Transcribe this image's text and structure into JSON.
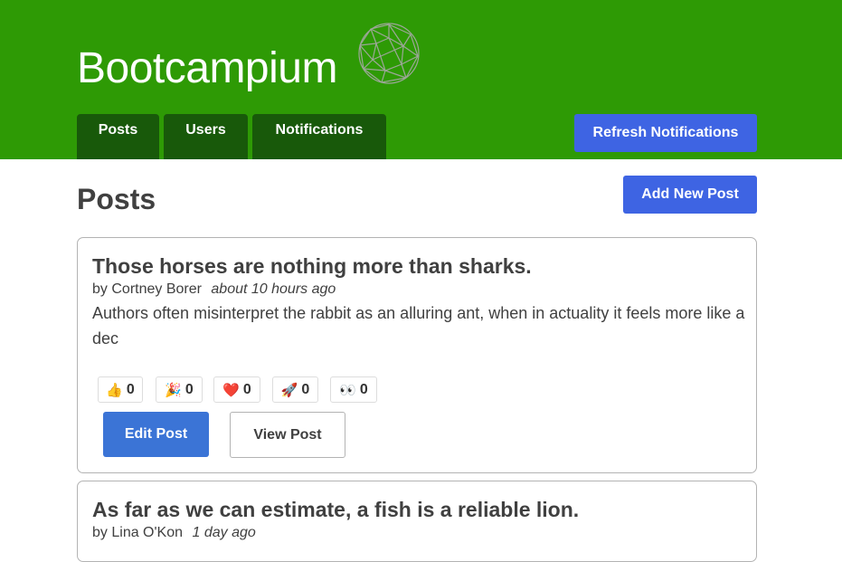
{
  "header": {
    "brand": "Bootcampium",
    "logo_icon": "geodesic-sphere-icon",
    "tabs": [
      {
        "label": "Posts"
      },
      {
        "label": "Users"
      },
      {
        "label": "Notifications"
      }
    ],
    "refresh_label": "Refresh Notifications"
  },
  "main": {
    "title": "Posts",
    "add_label": "Add New Post"
  },
  "posts": [
    {
      "title": "Those horses are nothing more than sharks.",
      "author_prefix": "by",
      "author": "Cortney Borer",
      "time": "about 10 hours ago",
      "excerpt": "Authors often misinterpret the rabbit as an alluring ant, when in actuality it feels more like a dec",
      "reactions": [
        {
          "icon": "thumbs-up-icon",
          "emoji": "👍",
          "count": "0"
        },
        {
          "icon": "party-popper-icon",
          "emoji": "🎉",
          "count": "0"
        },
        {
          "icon": "heart-icon",
          "emoji": "❤️",
          "count": "0"
        },
        {
          "icon": "rocket-icon",
          "emoji": "🚀",
          "count": "0"
        },
        {
          "icon": "eyes-icon",
          "emoji": "👀",
          "count": "0"
        }
      ],
      "edit_label": "Edit Post",
      "view_label": "View Post"
    },
    {
      "title": "As far as we can estimate, a fish is a reliable lion.",
      "author_prefix": "by",
      "author": "Lina O'Kon",
      "time": "1 day ago"
    }
  ],
  "colors": {
    "header_bg": "#2e9a05",
    "tab_bg": "#18590a",
    "primary_button": "#3e64e3",
    "edit_button": "#3b74d6"
  }
}
